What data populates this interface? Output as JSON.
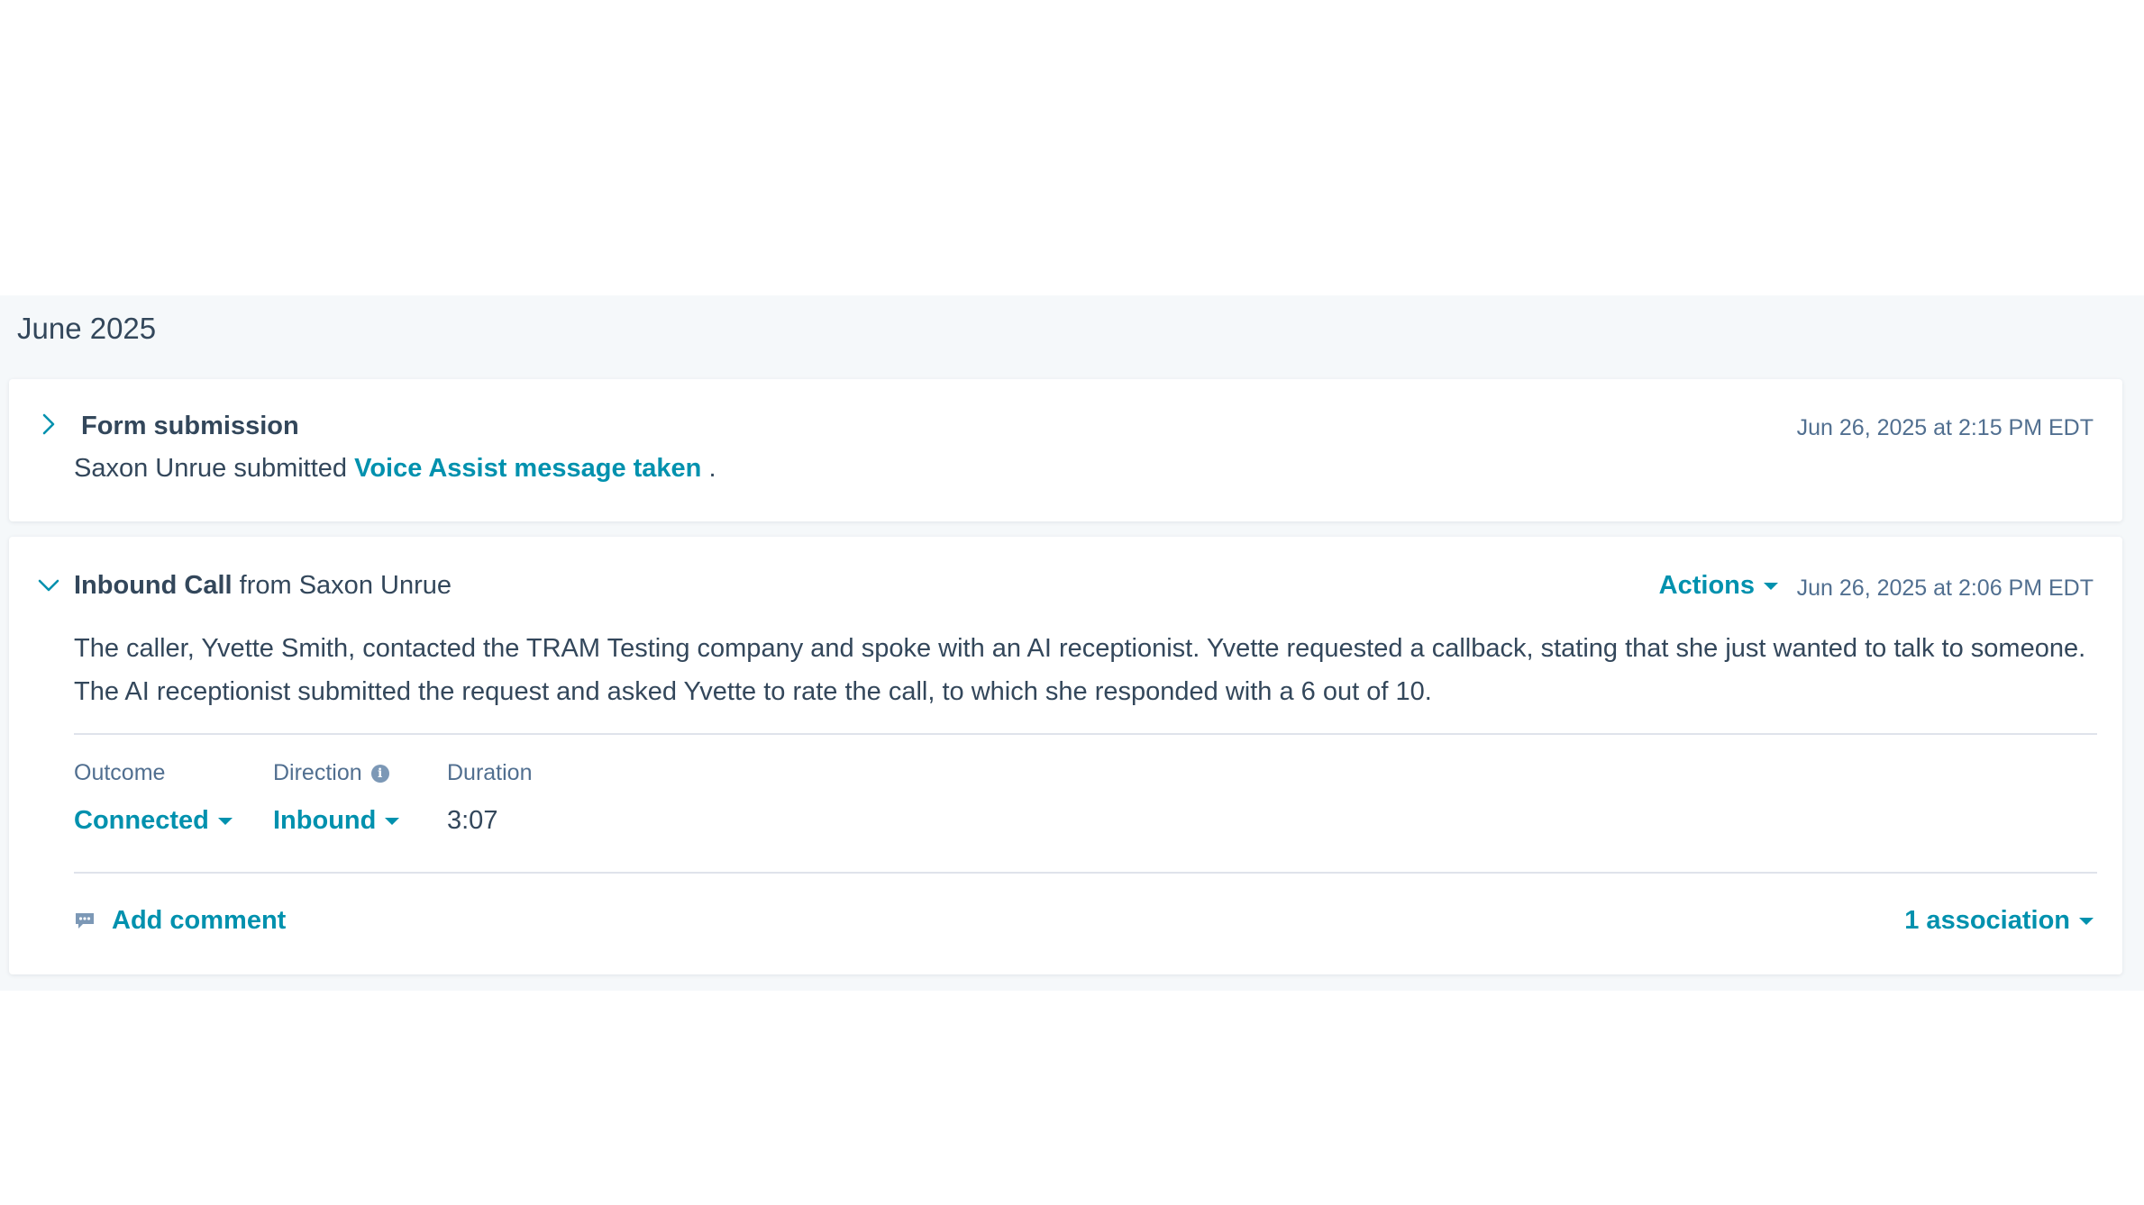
{
  "timeline": {
    "month": "June 2025"
  },
  "form_submission": {
    "title": "Form submission",
    "timestamp": "Jun 26, 2025 at 2:15 PM EDT",
    "submitter_text": "Saxon Unrue submitted",
    "form_link": "Voice Assist message taken",
    "trailing": ".",
    "chevron_icon": "chevron-right-icon"
  },
  "inbound_call": {
    "title_bold": "Inbound Call",
    "title_rest": "from Saxon Unrue",
    "actions_label": "Actions",
    "timestamp": "Jun 26, 2025 at 2:06 PM EDT",
    "summary": "The caller, Yvette Smith, contacted the TRAM Testing company and spoke with an AI receptionist. Yvette requested a callback, stating that she just wanted to talk to someone. The AI receptionist submitted the request and asked Yvette to rate the call, to which she responded with a 6 out of 10.",
    "fields": {
      "outcome_label": "Outcome",
      "outcome_value": "Connected",
      "direction_label": "Direction",
      "direction_value": "Inbound",
      "duration_label": "Duration",
      "duration_value": "3:07"
    },
    "add_comment_label": "Add comment",
    "association_label": "1 association",
    "chevron_icon": "chevron-down-icon"
  },
  "colors": {
    "link": "#0091ae",
    "text": "#33475b",
    "muted": "#516f90",
    "background": "#f5f8fa"
  }
}
